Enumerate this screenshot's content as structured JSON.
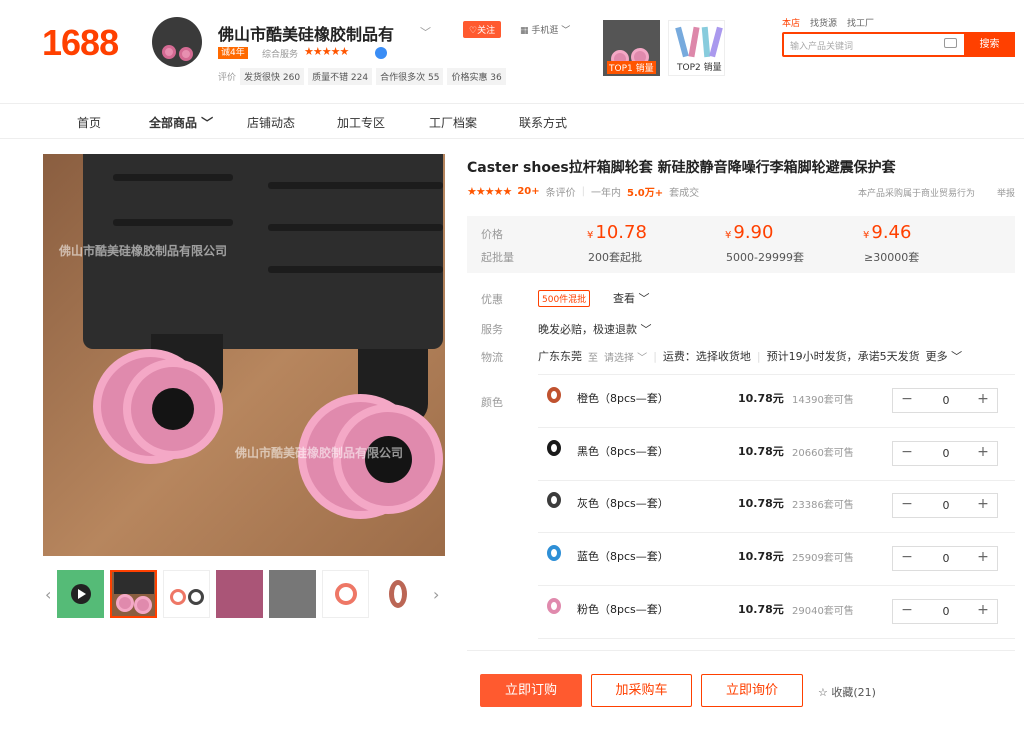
{
  "brand": {
    "logo": "1688"
  },
  "shop": {
    "name": "佛山市酷美硅橡胶制品有",
    "years_badge": "诚4年",
    "score_label": "综合服务",
    "stars": "★★★★★",
    "eval_label": "评价",
    "metrics": [
      "发货很快 260",
      "质量不错 224",
      "合作很多次 55",
      "价格实惠 36"
    ],
    "follow": "♡关注",
    "mobile": "▦ 手机逛 ﹀"
  },
  "top_items": [
    {
      "label": "TOP1 销量"
    },
    {
      "label": "TOP2 销量"
    }
  ],
  "search": {
    "tabs": [
      "本店",
      "找货源",
      "找工厂"
    ],
    "placeholder": "输入产品关键词",
    "button": "搜索"
  },
  "nav": [
    "首页",
    "全部商品 ﹀",
    "店铺动态",
    "加工专区",
    "工厂档案",
    "联系方式"
  ],
  "main_image": {
    "watermark1": "佛山市酷美硅橡胶制品有限公司",
    "watermark2": "佛山市酷美硅橡胶制品有限公司"
  },
  "product": {
    "title": "Caster shoes拉杆箱脚轮套 新硅胶静音降噪行李箱脚轮避震保护套",
    "stars": "★★★★★",
    "review_count": "20+",
    "review_label": "条评价",
    "period": "一年内",
    "sold": "5.0万+",
    "sold_label": "套成交",
    "policy": "本产品采购属于商业贸易行为",
    "report": "举报",
    "price_label": "价格",
    "moq_label": "起批量",
    "tiers": [
      {
        "price": "10.78",
        "qty": "200套起批"
      },
      {
        "price": "9.90",
        "qty": "5000-29999套"
      },
      {
        "price": "9.46",
        "qty": "≥30000套"
      }
    ],
    "currency": "¥",
    "promo_label": "优惠",
    "promo_tag": "500件混批",
    "promo_view": "查看 ﹀",
    "service_label": "服务",
    "service_text": "晚发必赔，极速退款 ﹀",
    "logistics_label": "物流",
    "logistics": {
      "from": "广东东莞",
      "to_label": "至",
      "to": "请选择 ﹀",
      "fee": "运费：选择收货地",
      "ship": "预计19小时发货，承诺5天发货",
      "more": "更多 ﹀"
    },
    "color_label": "颜色",
    "variants": [
      {
        "name": "橙色（8pcs—套）",
        "price": "10.78元",
        "stock": "14390套可售",
        "qty": "0",
        "color": "#c0522f"
      },
      {
        "name": "黑色（8pcs—套）",
        "price": "10.78元",
        "stock": "20660套可售",
        "qty": "0",
        "color": "#1a1a1a"
      },
      {
        "name": "灰色（8pcs—套）",
        "price": "10.78元",
        "stock": "23386套可售",
        "qty": "0",
        "color": "#3c3c3c"
      },
      {
        "name": "蓝色（8pcs—套）",
        "price": "10.78元",
        "stock": "25909套可售",
        "qty": "0",
        "color": "#2e8fd6"
      },
      {
        "name": "粉色（8pcs—套）",
        "price": "10.78元",
        "stock": "29040套可售",
        "qty": "0",
        "color": "#e08aad"
      }
    ],
    "minus": "−",
    "plus": "+"
  },
  "actions": {
    "order": "立即订购",
    "cart": "加采购车",
    "inquiry": "立即询价",
    "fav": "☆ 收藏(21)"
  },
  "thumbs": {
    "prev": "‹",
    "next": "›"
  }
}
